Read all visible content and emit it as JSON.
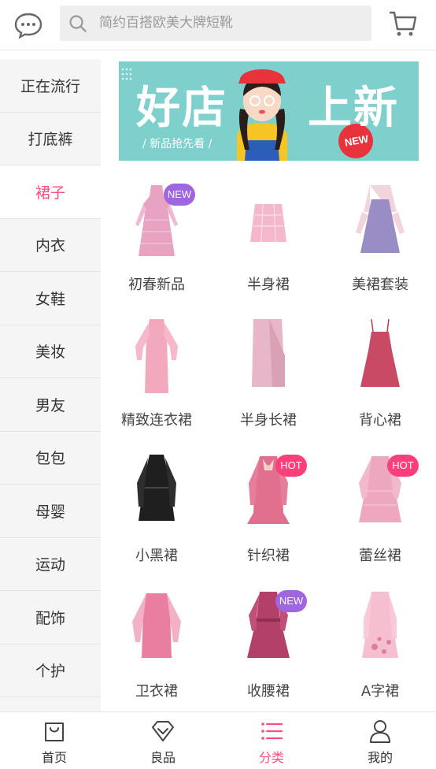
{
  "header": {
    "search_placeholder": "简约百搭欧美大牌短靴",
    "icons": [
      "chat-bubble-icon",
      "search-icon",
      "cart-icon"
    ]
  },
  "sidebar": {
    "items": [
      {
        "label": "正在流行",
        "active": false
      },
      {
        "label": "打底裤",
        "active": false
      },
      {
        "label": "裙子",
        "active": true
      },
      {
        "label": "内衣",
        "active": false
      },
      {
        "label": "女鞋",
        "active": false
      },
      {
        "label": "美妆",
        "active": false
      },
      {
        "label": "男友",
        "active": false
      },
      {
        "label": "包包",
        "active": false
      },
      {
        "label": "母婴",
        "active": false
      },
      {
        "label": "运动",
        "active": false
      },
      {
        "label": "配饰",
        "active": false
      },
      {
        "label": "个护",
        "active": false
      }
    ]
  },
  "banner": {
    "title_left": "好店",
    "title_right": "上新",
    "subtitle": "/ 新品抢先看 /",
    "badge": "NEW"
  },
  "categories": [
    {
      "label": "初春新品",
      "tag": "NEW"
    },
    {
      "label": "半身裙",
      "tag": ""
    },
    {
      "label": "美裙套装",
      "tag": ""
    },
    {
      "label": "精致连衣裙",
      "tag": ""
    },
    {
      "label": "半身长裙",
      "tag": ""
    },
    {
      "label": "背心裙",
      "tag": ""
    },
    {
      "label": "小黑裙",
      "tag": ""
    },
    {
      "label": "针织裙",
      "tag": "HOT"
    },
    {
      "label": "蕾丝裙",
      "tag": "HOT"
    },
    {
      "label": "卫衣裙",
      "tag": ""
    },
    {
      "label": "收腰裙",
      "tag": "NEW"
    },
    {
      "label": "A字裙",
      "tag": ""
    }
  ],
  "tabbar": {
    "items": [
      {
        "label": "首页",
        "active": false
      },
      {
        "label": "良品",
        "active": false
      },
      {
        "label": "分类",
        "active": true
      },
      {
        "label": "我的",
        "active": false
      }
    ]
  },
  "colors": {
    "accent": "#ff4d7a",
    "new_tag": "#a066e0",
    "hot_tag": "#ff3f7a",
    "banner_bg": "#7ed0cd"
  }
}
